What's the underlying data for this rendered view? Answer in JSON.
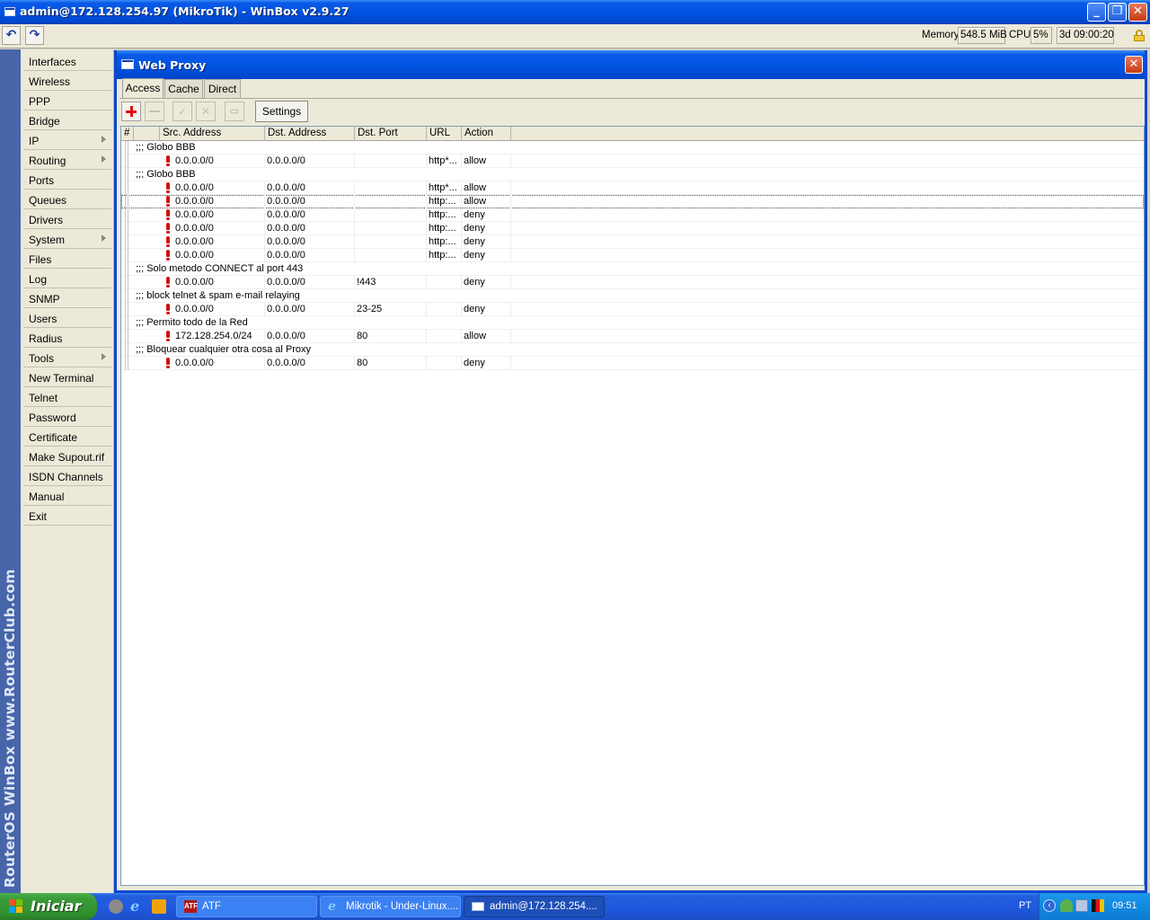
{
  "window": {
    "title": "admin@172.128.254.97 (MikroTik) - WinBox v2.9.27",
    "minimize_glyph": "_",
    "maximize_glyph": "❐",
    "close_glyph": "✕"
  },
  "toolbar": {
    "undo_glyph": "↶",
    "redo_glyph": "↷",
    "memory_label": "Memory:",
    "memory_value": "548.5 MiB",
    "cpu_label": "CPU:",
    "cpu_value": "5%",
    "uptime_value": "3d 09:00:20"
  },
  "brand": {
    "text": "RouterOS WinBox  www.RouterClub.com"
  },
  "sidebar": {
    "items": [
      {
        "label": "Interfaces",
        "submenu": false
      },
      {
        "label": "Wireless",
        "submenu": false
      },
      {
        "label": "PPP",
        "submenu": false
      },
      {
        "label": "Bridge",
        "submenu": false
      },
      {
        "label": "IP",
        "submenu": true
      },
      {
        "label": "Routing",
        "submenu": true
      },
      {
        "label": "Ports",
        "submenu": false
      },
      {
        "label": "Queues",
        "submenu": false
      },
      {
        "label": "Drivers",
        "submenu": false
      },
      {
        "label": "System",
        "submenu": true
      },
      {
        "label": "Files",
        "submenu": false
      },
      {
        "label": "Log",
        "submenu": false
      },
      {
        "label": "SNMP",
        "submenu": false
      },
      {
        "label": "Users",
        "submenu": false
      },
      {
        "label": "Radius",
        "submenu": false
      },
      {
        "label": "Tools",
        "submenu": true
      },
      {
        "label": "New Terminal",
        "submenu": false
      },
      {
        "label": "Telnet",
        "submenu": false
      },
      {
        "label": "Password",
        "submenu": false
      },
      {
        "label": "Certificate",
        "submenu": false
      },
      {
        "label": "Make Supout.rif",
        "submenu": false
      },
      {
        "label": "ISDN Channels",
        "submenu": false
      },
      {
        "label": "Manual",
        "submenu": false
      },
      {
        "label": "Exit",
        "submenu": false
      }
    ]
  },
  "proxy": {
    "title": "Web Proxy",
    "close_glyph": "✕",
    "tabs": [
      {
        "label": "Access",
        "active": true
      },
      {
        "label": "Cache",
        "active": false
      },
      {
        "label": "Direct",
        "active": false
      }
    ],
    "settings_label": "Settings",
    "columns": [
      "#",
      "Src. Address",
      "Dst. Address",
      "Dst. Port",
      "URL",
      "Action"
    ],
    "rows": [
      {
        "type": "comment",
        "text": ";;; Globo BBB"
      },
      {
        "type": "rule",
        "src": "0.0.0.0/0",
        "dst": "0.0.0.0/0",
        "port": "",
        "url": "http*...",
        "action": "allow"
      },
      {
        "type": "comment",
        "text": ";;; Globo BBB"
      },
      {
        "type": "rule",
        "src": "0.0.0.0/0",
        "dst": "0.0.0.0/0",
        "port": "",
        "url": "http*...",
        "action": "allow"
      },
      {
        "type": "rule",
        "src": "0.0.0.0/0",
        "dst": "0.0.0.0/0",
        "port": "",
        "url": "http:...",
        "action": "allow",
        "selected": true
      },
      {
        "type": "rule",
        "src": "0.0.0.0/0",
        "dst": "0.0.0.0/0",
        "port": "",
        "url": "http:...",
        "action": "deny"
      },
      {
        "type": "rule",
        "src": "0.0.0.0/0",
        "dst": "0.0.0.0/0",
        "port": "",
        "url": "http:...",
        "action": "deny"
      },
      {
        "type": "rule",
        "src": "0.0.0.0/0",
        "dst": "0.0.0.0/0",
        "port": "",
        "url": "http:...",
        "action": "deny"
      },
      {
        "type": "rule",
        "src": "0.0.0.0/0",
        "dst": "0.0.0.0/0",
        "port": "",
        "url": "http:...",
        "action": "deny"
      },
      {
        "type": "comment",
        "text": ";;; Solo metodo CONNECT al port 443"
      },
      {
        "type": "rule",
        "src": "0.0.0.0/0",
        "dst": "0.0.0.0/0",
        "port": "!443",
        "url": "",
        "action": "deny"
      },
      {
        "type": "comment",
        "text": ";;; block telnet & spam e-mail relaying"
      },
      {
        "type": "rule",
        "src": "0.0.0.0/0",
        "dst": "0.0.0.0/0",
        "port": "23-25",
        "url": "",
        "action": "deny"
      },
      {
        "type": "comment",
        "text": ";;; Permito todo de la Red"
      },
      {
        "type": "rule",
        "src": "172.128.254.0/24",
        "dst": "0.0.0.0/0",
        "port": "80",
        "url": "",
        "action": "allow"
      },
      {
        "type": "comment",
        "text": ";;; Bloquear cualquier otra cosa al Proxy"
      },
      {
        "type": "rule",
        "src": "0.0.0.0/0",
        "dst": "0.0.0.0/0",
        "port": "80",
        "url": "",
        "action": "deny"
      }
    ]
  },
  "taskbar": {
    "start_label": "Iniciar",
    "tasks": [
      {
        "label": "ATF",
        "active": false,
        "icon": "atf-icon"
      },
      {
        "label": "Mikrotik - Under-Linux....",
        "active": false,
        "icon": "ie-icon"
      },
      {
        "label": "admin@172.128.254....",
        "active": true,
        "icon": "winbox-icon"
      }
    ],
    "language": "PT",
    "clock": "09:51"
  },
  "colors": {
    "xp_blue": "#0053e1",
    "brand_strip": "#4765a9",
    "error_red": "#d10f0f",
    "start_green": "#3a9d3a"
  }
}
